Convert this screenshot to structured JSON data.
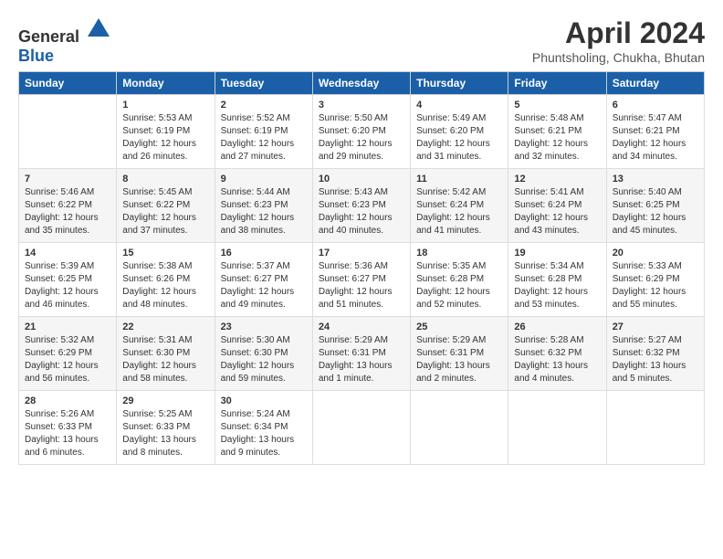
{
  "logo": {
    "general": "General",
    "blue": "Blue"
  },
  "title": "April 2024",
  "subtitle": "Phuntsholing, Chukha, Bhutan",
  "days_header": [
    "Sunday",
    "Monday",
    "Tuesday",
    "Wednesday",
    "Thursday",
    "Friday",
    "Saturday"
  ],
  "weeks": [
    [
      {
        "day": "",
        "info": ""
      },
      {
        "day": "1",
        "info": "Sunrise: 5:53 AM\nSunset: 6:19 PM\nDaylight: 12 hours\nand 26 minutes."
      },
      {
        "day": "2",
        "info": "Sunrise: 5:52 AM\nSunset: 6:19 PM\nDaylight: 12 hours\nand 27 minutes."
      },
      {
        "day": "3",
        "info": "Sunrise: 5:50 AM\nSunset: 6:20 PM\nDaylight: 12 hours\nand 29 minutes."
      },
      {
        "day": "4",
        "info": "Sunrise: 5:49 AM\nSunset: 6:20 PM\nDaylight: 12 hours\nand 31 minutes."
      },
      {
        "day": "5",
        "info": "Sunrise: 5:48 AM\nSunset: 6:21 PM\nDaylight: 12 hours\nand 32 minutes."
      },
      {
        "day": "6",
        "info": "Sunrise: 5:47 AM\nSunset: 6:21 PM\nDaylight: 12 hours\nand 34 minutes."
      }
    ],
    [
      {
        "day": "7",
        "info": "Sunrise: 5:46 AM\nSunset: 6:22 PM\nDaylight: 12 hours\nand 35 minutes."
      },
      {
        "day": "8",
        "info": "Sunrise: 5:45 AM\nSunset: 6:22 PM\nDaylight: 12 hours\nand 37 minutes."
      },
      {
        "day": "9",
        "info": "Sunrise: 5:44 AM\nSunset: 6:23 PM\nDaylight: 12 hours\nand 38 minutes."
      },
      {
        "day": "10",
        "info": "Sunrise: 5:43 AM\nSunset: 6:23 PM\nDaylight: 12 hours\nand 40 minutes."
      },
      {
        "day": "11",
        "info": "Sunrise: 5:42 AM\nSunset: 6:24 PM\nDaylight: 12 hours\nand 41 minutes."
      },
      {
        "day": "12",
        "info": "Sunrise: 5:41 AM\nSunset: 6:24 PM\nDaylight: 12 hours\nand 43 minutes."
      },
      {
        "day": "13",
        "info": "Sunrise: 5:40 AM\nSunset: 6:25 PM\nDaylight: 12 hours\nand 45 minutes."
      }
    ],
    [
      {
        "day": "14",
        "info": "Sunrise: 5:39 AM\nSunset: 6:25 PM\nDaylight: 12 hours\nand 46 minutes."
      },
      {
        "day": "15",
        "info": "Sunrise: 5:38 AM\nSunset: 6:26 PM\nDaylight: 12 hours\nand 48 minutes."
      },
      {
        "day": "16",
        "info": "Sunrise: 5:37 AM\nSunset: 6:27 PM\nDaylight: 12 hours\nand 49 minutes."
      },
      {
        "day": "17",
        "info": "Sunrise: 5:36 AM\nSunset: 6:27 PM\nDaylight: 12 hours\nand 51 minutes."
      },
      {
        "day": "18",
        "info": "Sunrise: 5:35 AM\nSunset: 6:28 PM\nDaylight: 12 hours\nand 52 minutes."
      },
      {
        "day": "19",
        "info": "Sunrise: 5:34 AM\nSunset: 6:28 PM\nDaylight: 12 hours\nand 53 minutes."
      },
      {
        "day": "20",
        "info": "Sunrise: 5:33 AM\nSunset: 6:29 PM\nDaylight: 12 hours\nand 55 minutes."
      }
    ],
    [
      {
        "day": "21",
        "info": "Sunrise: 5:32 AM\nSunset: 6:29 PM\nDaylight: 12 hours\nand 56 minutes."
      },
      {
        "day": "22",
        "info": "Sunrise: 5:31 AM\nSunset: 6:30 PM\nDaylight: 12 hours\nand 58 minutes."
      },
      {
        "day": "23",
        "info": "Sunrise: 5:30 AM\nSunset: 6:30 PM\nDaylight: 12 hours\nand 59 minutes."
      },
      {
        "day": "24",
        "info": "Sunrise: 5:29 AM\nSunset: 6:31 PM\nDaylight: 13 hours\nand 1 minute."
      },
      {
        "day": "25",
        "info": "Sunrise: 5:29 AM\nSunset: 6:31 PM\nDaylight: 13 hours\nand 2 minutes."
      },
      {
        "day": "26",
        "info": "Sunrise: 5:28 AM\nSunset: 6:32 PM\nDaylight: 13 hours\nand 4 minutes."
      },
      {
        "day": "27",
        "info": "Sunrise: 5:27 AM\nSunset: 6:32 PM\nDaylight: 13 hours\nand 5 minutes."
      }
    ],
    [
      {
        "day": "28",
        "info": "Sunrise: 5:26 AM\nSunset: 6:33 PM\nDaylight: 13 hours\nand 6 minutes."
      },
      {
        "day": "29",
        "info": "Sunrise: 5:25 AM\nSunset: 6:33 PM\nDaylight: 13 hours\nand 8 minutes."
      },
      {
        "day": "30",
        "info": "Sunrise: 5:24 AM\nSunset: 6:34 PM\nDaylight: 13 hours\nand 9 minutes."
      },
      {
        "day": "",
        "info": ""
      },
      {
        "day": "",
        "info": ""
      },
      {
        "day": "",
        "info": ""
      },
      {
        "day": "",
        "info": ""
      }
    ]
  ]
}
